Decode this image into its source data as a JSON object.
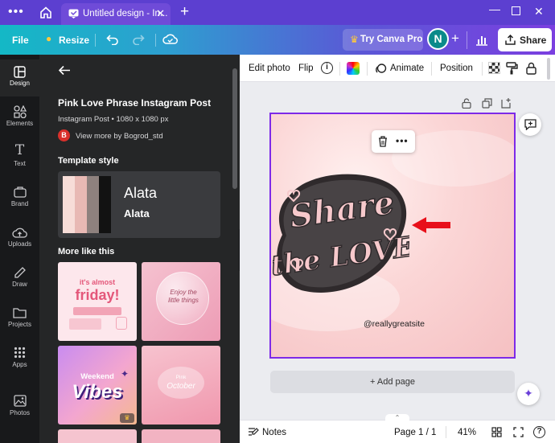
{
  "window": {
    "tab_title": "Untitled design - In...",
    "controls": [
      "minimize",
      "maximize",
      "close"
    ]
  },
  "toolbar": {
    "file_label": "File",
    "resize_label": "Resize",
    "try_pro_label": "Try Canva Pro",
    "avatar_initial": "N",
    "share_label": "Share"
  },
  "rail": {
    "items": [
      {
        "label": "Design",
        "icon": "design-icon"
      },
      {
        "label": "Elements",
        "icon": "shapes-icon"
      },
      {
        "label": "Text",
        "icon": "text-icon"
      },
      {
        "label": "Brand",
        "icon": "brand-icon"
      },
      {
        "label": "Uploads",
        "icon": "cloud-upload-icon"
      },
      {
        "label": "Draw",
        "icon": "pen-icon"
      },
      {
        "label": "Projects",
        "icon": "folder-icon"
      },
      {
        "label": "Apps",
        "icon": "apps-grid-icon"
      },
      {
        "label": "Photos",
        "icon": "photo-icon"
      }
    ]
  },
  "panel": {
    "template_title": "Pink Love Phrase Instagram Post",
    "template_meta": "Instagram Post • 1080 x 1080 px",
    "author_initial": "B",
    "author_link": "View more by Bogrod_std",
    "template_style_heading": "Template style",
    "font_primary": "Alata",
    "font_secondary": "Alata",
    "palette": [
      "#f7ddd8",
      "#e8b9b4",
      "#8e817e",
      "#121212"
    ],
    "more_like_heading": "More like this",
    "thumb_texts": {
      "friday_line1": "it's almost",
      "friday_line2": "friday!",
      "enjoy_text": "Enjoy the little things",
      "weekend_line1": "Weekend",
      "weekend_line2": "Vibes",
      "october_line1": "Pink",
      "october_line2": "October"
    }
  },
  "context_bar": {
    "edit_photo": "Edit photo",
    "flip": "Flip",
    "animate": "Animate",
    "position": "Position"
  },
  "design": {
    "headline_line1": "Share",
    "headline_line2": "the LOVE",
    "handle": "@reallygreatsite"
  },
  "canvas": {
    "add_page": "+ Add page"
  },
  "bottom": {
    "notes": "Notes",
    "page": "Page 1 / 1",
    "zoom": "41%"
  },
  "colors": {
    "tabbar": "#5c3fd0",
    "panel_bg": "#252627",
    "selection": "#7d2ae8",
    "arrow": "#e8101a"
  }
}
